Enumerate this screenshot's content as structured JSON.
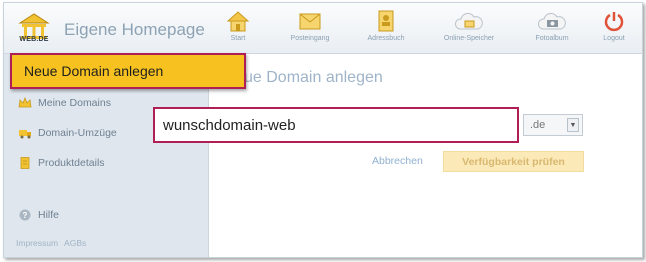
{
  "header": {
    "logo_text": "WEB.DE",
    "app_title": "Eigene Homepage",
    "nav": [
      {
        "label": "Start",
        "icon": "house-icon"
      },
      {
        "label": "Posteingang",
        "icon": "envelope-icon"
      },
      {
        "label": "Adressbuch",
        "icon": "address-book-icon"
      },
      {
        "label": "Online-Speicher",
        "icon": "cloud-storage-icon"
      },
      {
        "label": "Fotoalbum",
        "icon": "camera-cloud-icon"
      },
      {
        "label": "Logout",
        "icon": "power-icon"
      }
    ]
  },
  "sidebar": {
    "new_domain_label": "Neue Domain anlegen",
    "items": [
      {
        "label": "Meine Domains",
        "icon": "crown-icon"
      },
      {
        "label": "Domain-Umzüge",
        "icon": "truck-icon"
      },
      {
        "label": "Produktdetails",
        "icon": "document-icon"
      }
    ],
    "help_label": "Hilfe",
    "footer": {
      "impressum": "Impressum",
      "agbs": "AGBs"
    }
  },
  "main": {
    "title": "ue Domain anlegen",
    "domain_value": "wunschdomain-web",
    "tld_value": ".de",
    "cancel_label": "Abbrechen",
    "check_label": "Verfügbarkeit prüfen"
  },
  "colors": {
    "highlight_border": "#b01e56",
    "accent_yellow": "#f7c21f",
    "sidebar_bg": "#dfe6ee"
  }
}
